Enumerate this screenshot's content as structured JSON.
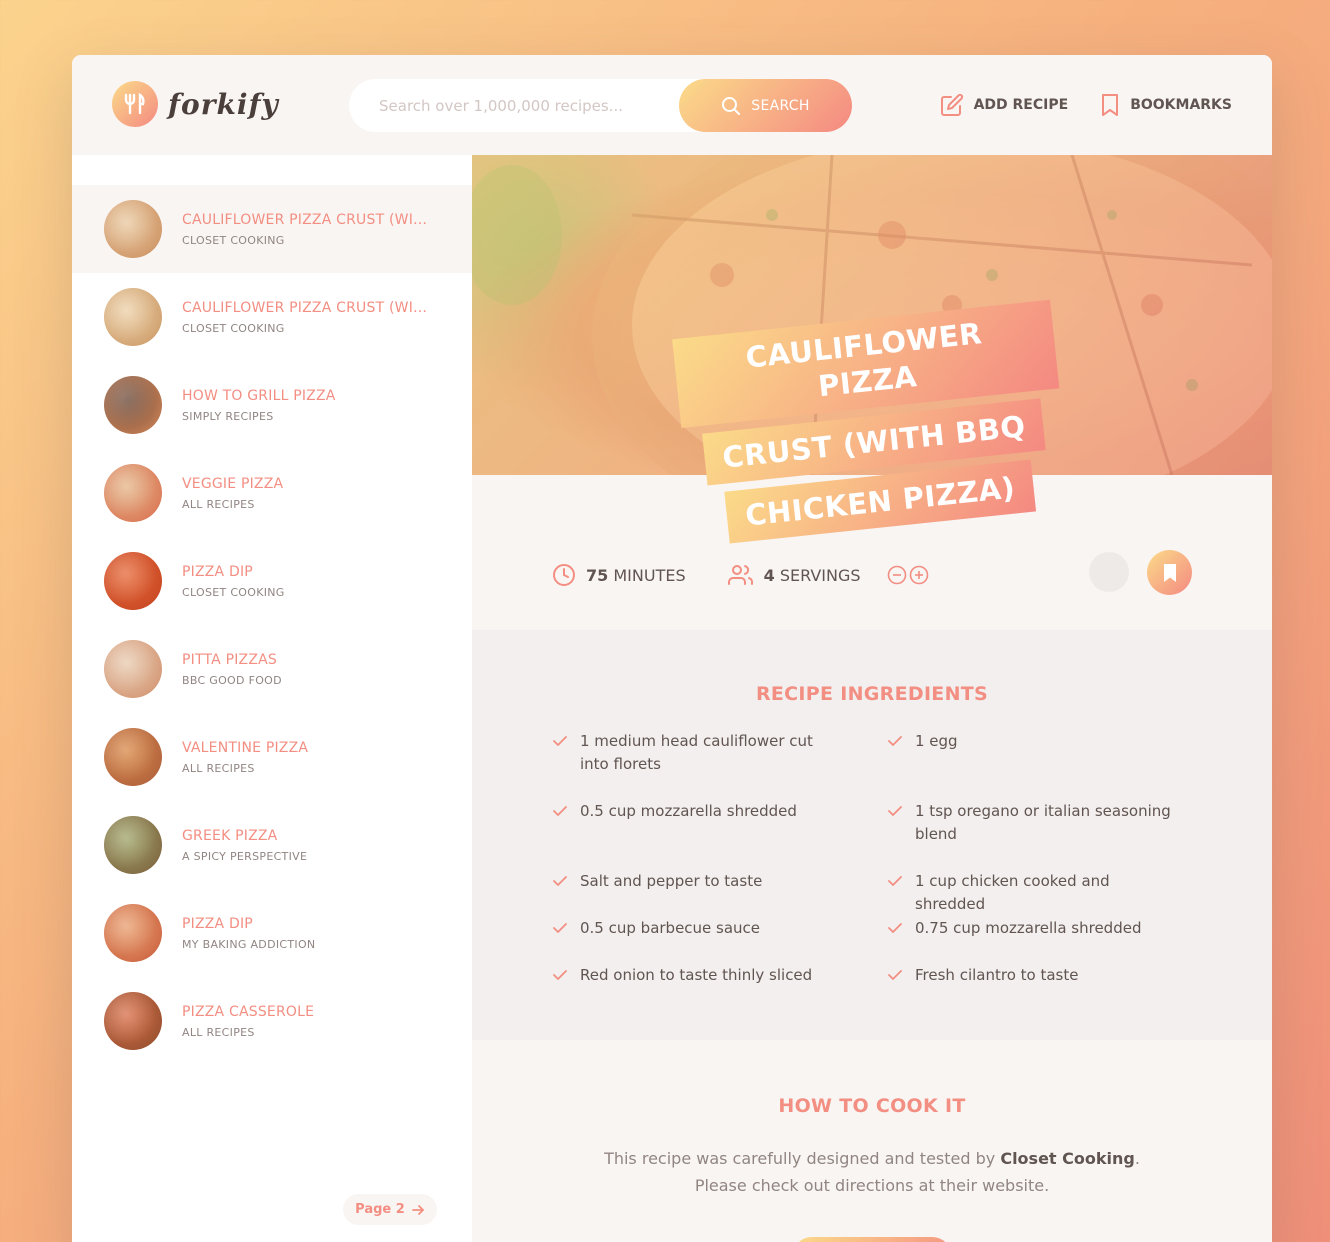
{
  "header": {
    "logo_text": "forkify",
    "search_placeholder": "Search over 1,000,000 recipes...",
    "search_button": "SEARCH",
    "add_recipe": "ADD RECIPE",
    "bookmarks": "BOOKMARKS"
  },
  "results": [
    {
      "title": "CAULIFLOWER PIZZA CRUST (WITH BBQ CHICKEN PIZZA)",
      "publisher": "CLOSET COOKING",
      "colors": [
        "#e9c9a0",
        "#c98a5a"
      ]
    },
    {
      "title": "CAULIFLOWER PIZZA CRUST (WITH BBQ CHICKEN PIZZA)",
      "publisher": "CLOSET COOKING",
      "colors": [
        "#ecd0a8",
        "#c9945f"
      ]
    },
    {
      "title": "HOW TO GRILL PIZZA",
      "publisher": "SIMPLY RECIPES",
      "colors": [
        "#6b4a3a",
        "#d98a5a"
      ]
    },
    {
      "title": "VEGGIE PIZZA",
      "publisher": "ALL RECIPES",
      "colors": [
        "#e4b68a",
        "#d96a4a"
      ]
    },
    {
      "title": "PIZZA DIP",
      "publisher": "CLOSET COOKING",
      "colors": [
        "#e56a3a",
        "#c2401f"
      ]
    },
    {
      "title": "PITTA PIZZAS",
      "publisher": "BBC GOOD FOOD",
      "colors": [
        "#e8cbb0",
        "#d08d6a"
      ]
    },
    {
      "title": "VALENTINE PIZZA",
      "publisher": "ALL RECIPES",
      "colors": [
        "#d98a4a",
        "#a85a3a"
      ]
    },
    {
      "title": "GREEK PIZZA",
      "publisher": "A SPICY PERSPECTIVE",
      "colors": [
        "#a0a56a",
        "#7a5a3a"
      ]
    },
    {
      "title": "PIZZA DIP",
      "publisher": "MY BAKING ADDICTION",
      "colors": [
        "#e8a070",
        "#c85a3a"
      ]
    },
    {
      "title": "PIZZA CASSEROLE",
      "publisher": "ALL RECIPES",
      "colors": [
        "#d9704a",
        "#8a4a2a"
      ]
    }
  ],
  "pagination": {
    "next_label": "Page 2"
  },
  "recipe": {
    "title_lines": [
      "CAULIFLOWER PIZZA",
      "CRUST (WITH BBQ",
      "CHICKEN PIZZA)"
    ],
    "cooking_time": "75",
    "cooking_time_unit": "MINUTES",
    "servings": "4",
    "servings_unit": "SERVINGS",
    "ingredients_heading": "RECIPE INGREDIENTS",
    "ingredients": [
      "1 medium head cauliflower cut into florets",
      "1 egg",
      "0.5 cup mozzarella shredded",
      "1 tsp oregano or italian seasoning blend",
      " Salt and pepper to taste",
      "1 cup chicken cooked and shredded",
      "0.5 cup barbecue sauce",
      "0.75 cup mozzarella shredded",
      " Red onion to taste thinly sliced",
      " Fresh cilantro to taste"
    ],
    "cook_heading": "HOW TO COOK IT",
    "cook_text_1": "This recipe was carefully designed and tested by ",
    "cook_publisher": "Closet Cooking",
    "cook_text_2": ". Please check out directions at their website."
  },
  "colors": {
    "accent_start": "#fbdb89",
    "accent_end": "#f48982",
    "text": "#615551",
    "accent_text": "#f38e82"
  }
}
